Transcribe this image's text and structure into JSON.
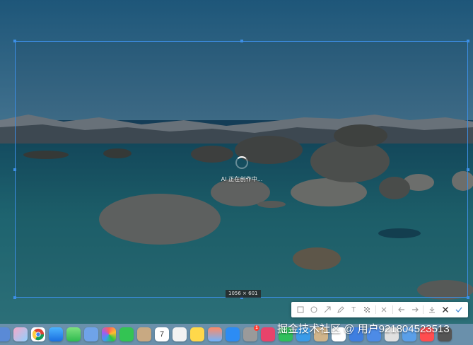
{
  "overlay": {
    "loading_text": "AI 正在创作中...",
    "size_label": "1056 × 601"
  },
  "toolbar": {
    "tools": [
      {
        "name": "rectangle-tool",
        "icon": "rectangle-icon"
      },
      {
        "name": "ellipse-tool",
        "icon": "circle-icon"
      },
      {
        "name": "arrow-tool",
        "icon": "arrow-icon"
      },
      {
        "name": "pen-tool",
        "icon": "pen-icon"
      },
      {
        "name": "text-tool",
        "icon": "text-icon",
        "label": "T"
      },
      {
        "name": "mosaic-tool",
        "icon": "mosaic-icon"
      },
      {
        "name": "pin-tool",
        "icon": "pin-icon"
      },
      {
        "name": "undo-button",
        "icon": "undo-icon"
      },
      {
        "name": "redo-button",
        "icon": "redo-icon"
      },
      {
        "name": "download-button",
        "icon": "download-icon"
      },
      {
        "name": "cancel-button",
        "icon": "close-icon"
      },
      {
        "name": "confirm-button",
        "icon": "check-icon"
      }
    ],
    "text_label": "T"
  },
  "dock": {
    "calendar_day": "7",
    "badge_count": "1"
  },
  "watermark": "掘金技术社区 @ 用户921804523513",
  "colors": {
    "selection_border": "#3d8fe6",
    "confirm": "#4a90d9"
  }
}
